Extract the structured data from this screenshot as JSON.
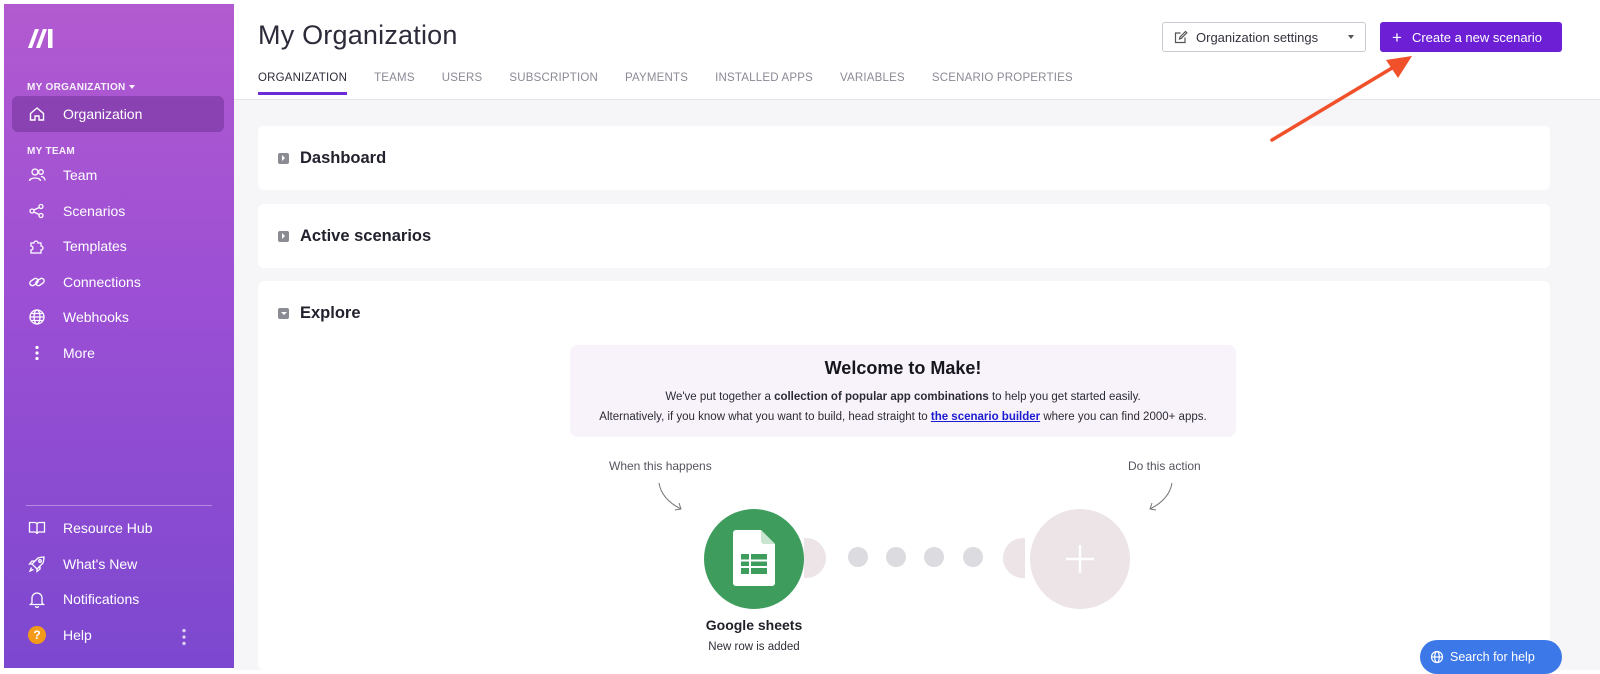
{
  "sidebar": {
    "org_label": "MY ORGANIZATION",
    "team_label": "MY TEAM",
    "items": [
      {
        "label": "Organization",
        "icon": "home-icon",
        "active": true
      },
      {
        "label": "Team",
        "icon": "users-icon"
      },
      {
        "label": "Scenarios",
        "icon": "share-nodes-icon"
      },
      {
        "label": "Templates",
        "icon": "puzzle-icon"
      },
      {
        "label": "Connections",
        "icon": "link-icon"
      },
      {
        "label": "Webhooks",
        "icon": "globe-icon"
      },
      {
        "label": "More",
        "icon": "vertical-dots-icon"
      }
    ],
    "bottom_items": [
      {
        "label": "Resource Hub",
        "icon": "book-icon"
      },
      {
        "label": "What's New",
        "icon": "rocket-icon"
      },
      {
        "label": "Notifications",
        "icon": "bell-icon"
      },
      {
        "label": "Help",
        "icon": "help-badge-icon",
        "badge": "?"
      }
    ]
  },
  "header": {
    "title": "My Organization",
    "tabs": [
      "ORGANIZATION",
      "TEAMS",
      "USERS",
      "SUBSCRIPTION",
      "PAYMENTS",
      "INSTALLED APPS",
      "VARIABLES",
      "SCENARIO PROPERTIES"
    ],
    "settings_label": "Organization settings",
    "create_label": "Create a new scenario"
  },
  "sections": {
    "dashboard": "Dashboard",
    "active": "Active scenarios",
    "explore": "Explore"
  },
  "welcome": {
    "title": "Welcome to Make!",
    "line1_pre": "We've put together a ",
    "line1_bold": "collection of popular app combinations",
    "line1_post": " to help you get started easily.",
    "line2_pre": "Alternatively, if you know what you want to build, head straight to ",
    "line2_link": "the scenario builder",
    "line2_post": " where you can find 2000+ apps."
  },
  "flow": {
    "trigger_label": "When this happens",
    "action_label": "Do this action",
    "app_name": "Google sheets",
    "app_event": "New row is added"
  },
  "help_pill": "Search for help",
  "colors": {
    "accent": "#6c1fd4",
    "sheets_green": "#3e9c5d",
    "annotation_arrow": "#f0502a"
  }
}
